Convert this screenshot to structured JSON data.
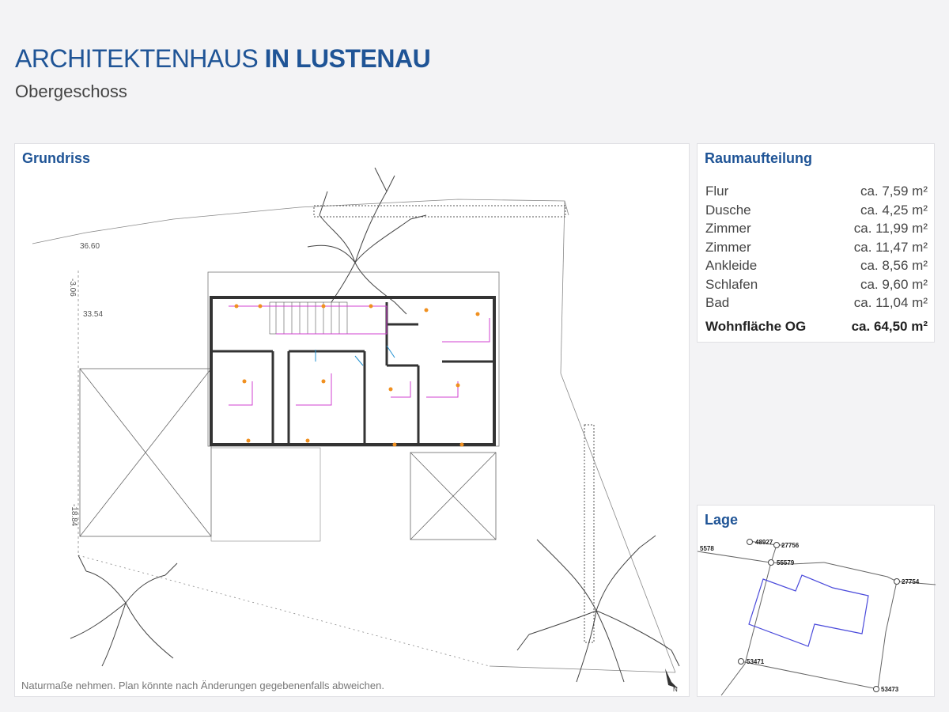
{
  "header": {
    "title_light": "ARCHITEKTENHAUS",
    "title_bold": "IN LUSTENAU",
    "subtitle": "Obergeschoss"
  },
  "plan": {
    "heading": "Grundriss",
    "note": "Naturmaße nehmen. Plan könnte nach Änderungen gegebenenfalls abweichen.",
    "dim_1": "36.60",
    "dim_2": "33.54",
    "dim_3": "-3.06",
    "dim_4": "-18.84",
    "north_mark": "N"
  },
  "rooms": {
    "heading": "Raumaufteilung",
    "items": [
      {
        "name": "Flur",
        "area": "ca. 7,59 m²"
      },
      {
        "name": "Dusche",
        "area": "ca. 4,25 m²"
      },
      {
        "name": "Zimmer",
        "area": "ca. 11,99 m²"
      },
      {
        "name": "Zimmer",
        "area": "ca. 11,47 m²"
      },
      {
        "name": "Ankleide",
        "area": "ca. 8,56 m²"
      },
      {
        "name": "Schlafen",
        "area": "ca. 9,60 m²"
      },
      {
        "name": "Bad",
        "area": "ca. 11,04 m²"
      }
    ],
    "total_label": "Wohnfläche OG",
    "total_area": "ca. 64,50 m²"
  },
  "map": {
    "heading": "Lage",
    "parcels": [
      "48927",
      "27756",
      "5578",
      "55579",
      "27754",
      "53471",
      "53473"
    ]
  },
  "colors": {
    "accent": "#1f5496",
    "plot_outline": "#4a4adb"
  }
}
